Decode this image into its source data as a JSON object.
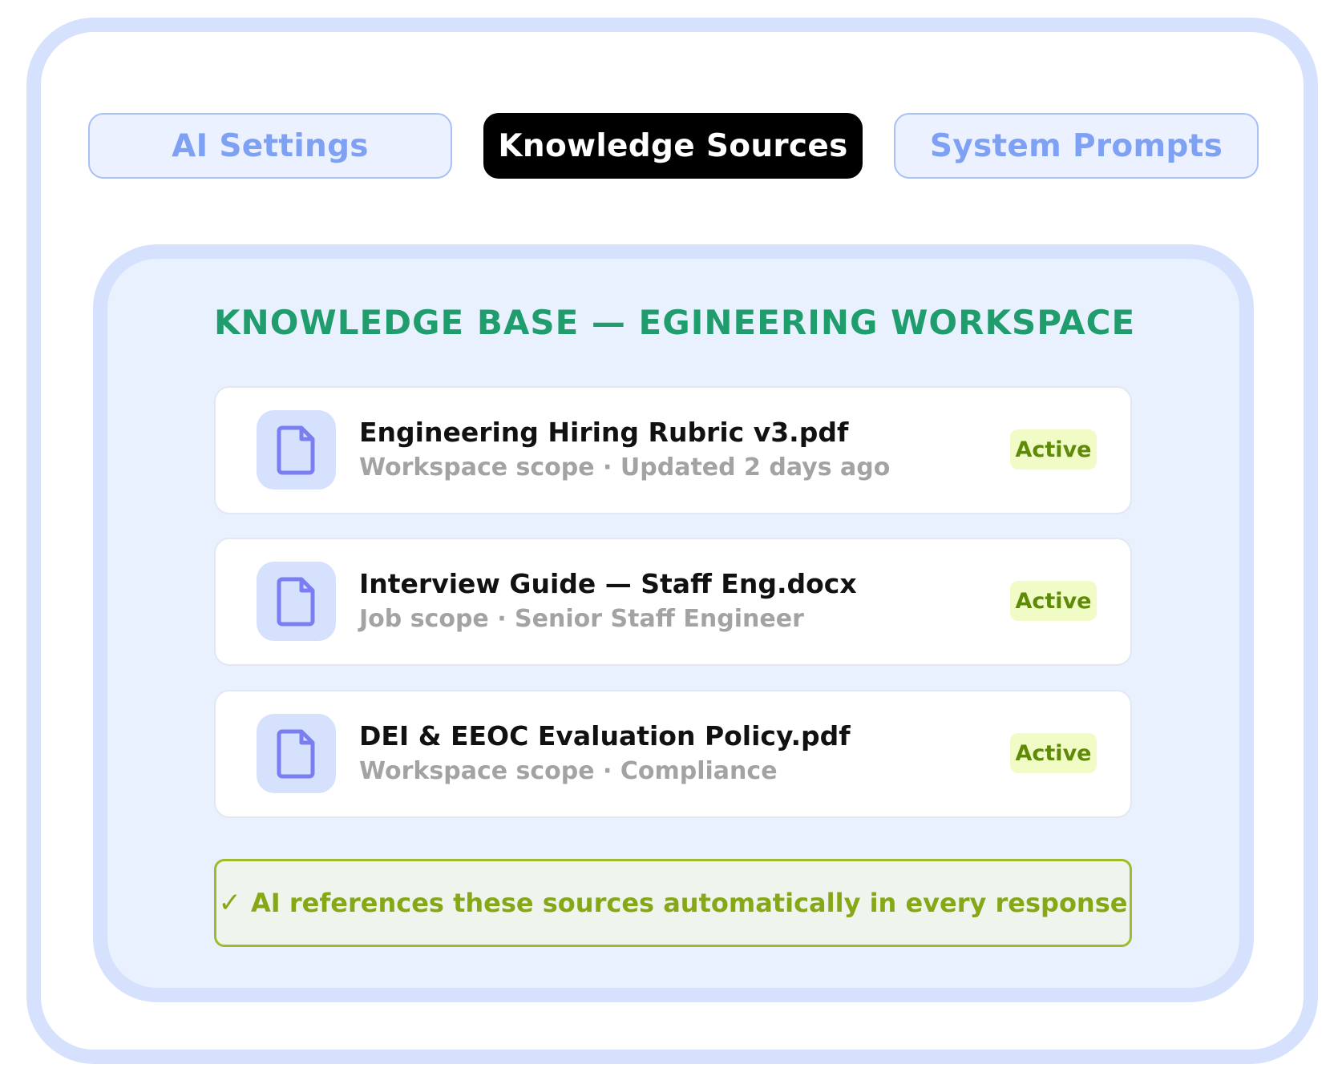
{
  "tabs": [
    {
      "label": "AI Settings",
      "active": false
    },
    {
      "label": "Knowledge Sources",
      "active": true
    },
    {
      "label": "System Prompts",
      "active": false
    }
  ],
  "panel": {
    "title": "KNOWLEDGE BASE — EGINEERING WORKSPACE",
    "documents": [
      {
        "name": "Engineering Hiring Rubric v3.pdf",
        "meta": "Workspace scope · Updated 2 days ago",
        "status": "Active",
        "icon": "document-icon"
      },
      {
        "name": "Interview Guide — Staff Eng.docx",
        "meta": "Job scope · Senior Staff Engineer",
        "status": "Active",
        "icon": "document-icon"
      },
      {
        "name": "DEI & EEOC Evaluation Policy.pdf",
        "meta": "Workspace scope · Compliance",
        "status": "Active",
        "icon": "document-icon"
      }
    ],
    "banner": {
      "check": "✓",
      "text": "AI references these sources automatically in every response"
    }
  },
  "colors": {
    "frame": "#d6e2fd",
    "panel_bg": "#e9f0fe",
    "tab_inactive_text": "#7ea1f4",
    "title": "#1f9d6c",
    "icon": "#7a7ef0",
    "badge_bg": "#f0fbc5",
    "badge_text": "#5e8a08",
    "banner_border": "#9fbb2c",
    "banner_text": "#86a716"
  }
}
